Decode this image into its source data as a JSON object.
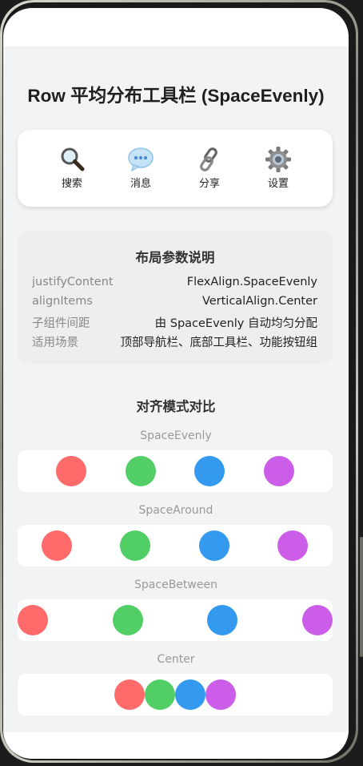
{
  "page": {
    "title": "Row 平均分布工具栏 (SpaceEvenly)"
  },
  "toolbar": {
    "items": [
      {
        "label": "搜索",
        "icon": "search-icon"
      },
      {
        "label": "消息",
        "icon": "message-icon"
      },
      {
        "label": "分享",
        "icon": "link-icon"
      },
      {
        "label": "设置",
        "icon": "gear-icon"
      }
    ]
  },
  "info": {
    "title": "布局参数说明",
    "rows": [
      {
        "key": "justifyContent",
        "value": "FlexAlign.SpaceEvenly"
      },
      {
        "key": "alignItems",
        "value": "VerticalAlign.Center"
      },
      {
        "key": "子组件间距",
        "value": "由 SpaceEvenly 自动均匀分配"
      },
      {
        "key": "适用场景",
        "value": "顶部导航栏、底部工具栏、功能按钮组"
      }
    ]
  },
  "comparison": {
    "title": "对齐模式对比",
    "dot_colors": [
      "#ff6b6b",
      "#51cf66",
      "#339af0",
      "#cc5de8"
    ],
    "modes": [
      {
        "name": "SpaceEvenly"
      },
      {
        "name": "SpaceAround"
      },
      {
        "name": "SpaceBetween"
      },
      {
        "name": "Center"
      }
    ]
  }
}
